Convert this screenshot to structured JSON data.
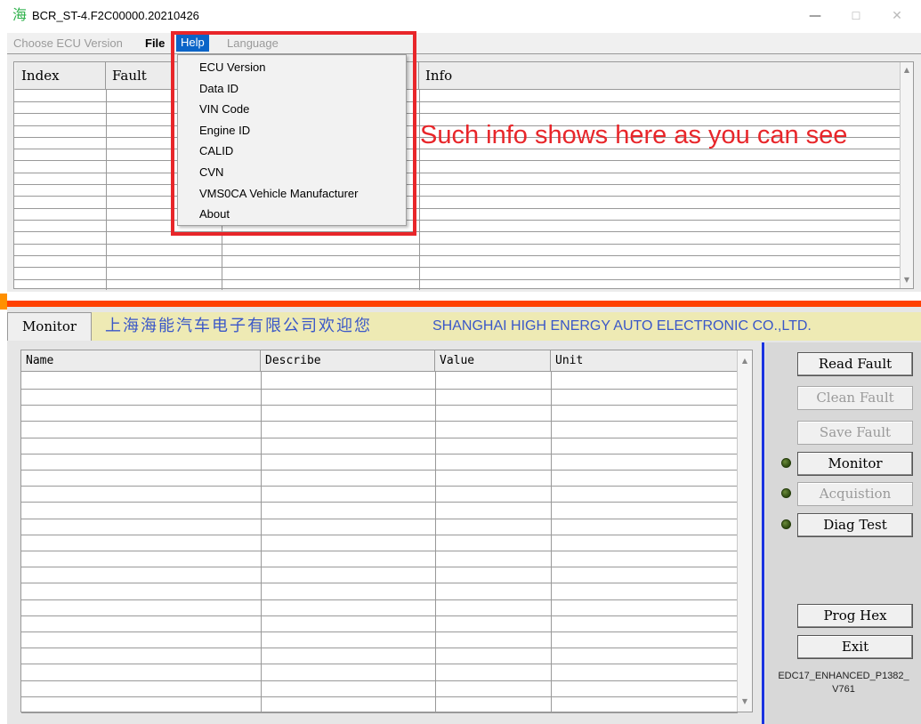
{
  "window": {
    "icon_glyph": "海",
    "title": "BCR_ST-4.F2C00000.20210426",
    "minimize_glyph": "—",
    "maximize_glyph": "☐",
    "close_glyph": "✕"
  },
  "menubar": {
    "choose_ecu": "Choose ECU Version",
    "file": "File",
    "help": "Help",
    "language": "Language"
  },
  "help_menu": {
    "items": [
      "ECU Version",
      "Data ID",
      "VIN Code",
      "Engine ID",
      "CALID",
      "CVN",
      "VMS0CA Vehicle Manufacturer",
      "About"
    ]
  },
  "fault_table": {
    "headers": {
      "index": "Index",
      "fault": "Fault",
      "info": "Info"
    }
  },
  "annotation": "Such info shows here as you can see",
  "monitor": {
    "tab": "Monitor",
    "welcome_cn": "上海海能汽车电子有限公司欢迎您",
    "welcome_en": "SHANGHAI HIGH ENERGY AUTO ELECTRONIC CO.,LTD.",
    "headers": {
      "name": "Name",
      "describe": "Describe",
      "value": "Value",
      "unit": "Unit"
    }
  },
  "buttons": {
    "read_fault": "Read Fault",
    "clean_fault": "Clean Fault",
    "save_fault": "Save Fault",
    "monitor": "Monitor",
    "acquistion": "Acquistion",
    "diag_test": "Diag Test",
    "prog_hex": "Prog Hex",
    "exit": "Exit"
  },
  "version_label": "EDC17_ENHANCED_P1382_ V761",
  "scroll": {
    "up": "▲",
    "down": "▼"
  },
  "colors": {
    "help_highlight": "#0a64c8",
    "annotation_red": "#e8262a",
    "welcome_blue": "#3a57c8",
    "separator_orange": "#ff4000"
  }
}
